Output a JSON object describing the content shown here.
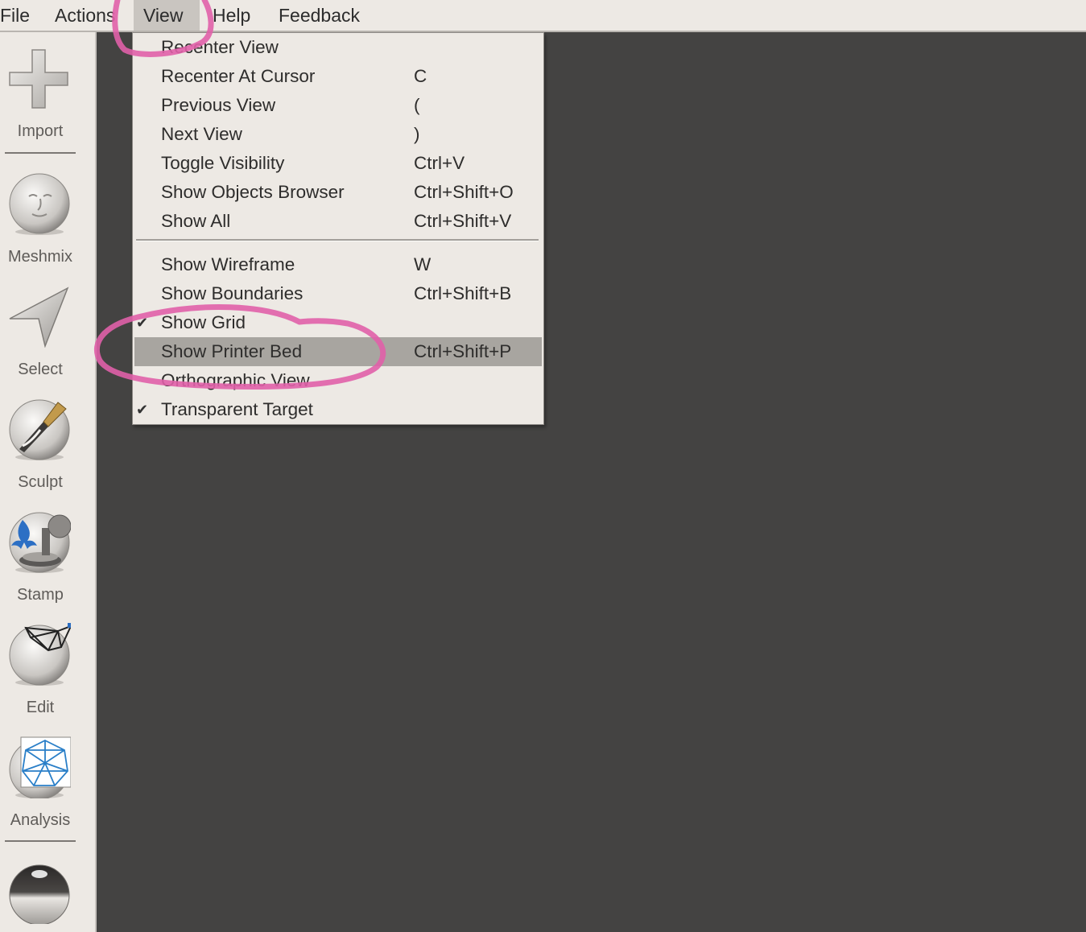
{
  "menubar": {
    "items": [
      "File",
      "Actions",
      "View",
      "Help",
      "Feedback"
    ],
    "active": "View"
  },
  "toolbar": {
    "tools": [
      {
        "label": "Import",
        "icon": "plus-icon"
      },
      {
        "label": "Meshmix",
        "icon": "face-sphere-icon"
      },
      {
        "label": "Select",
        "icon": "cursor-arrow-icon"
      },
      {
        "label": "Sculpt",
        "icon": "brush-sphere-icon"
      },
      {
        "label": "Stamp",
        "icon": "fleur-de-lis-stamp-icon"
      },
      {
        "label": "Edit",
        "icon": "wireframe-sphere-icon"
      },
      {
        "label": "Analysis",
        "icon": "mesh-analysis-icon"
      },
      {
        "label": "",
        "icon": "chrome-sphere-icon"
      }
    ]
  },
  "view_menu": {
    "group1": [
      {
        "label": "Recenter View",
        "shortcut": ""
      },
      {
        "label": "Recenter At Cursor",
        "shortcut": "C"
      },
      {
        "label": "Previous View",
        "shortcut": "("
      },
      {
        "label": "Next View",
        "shortcut": ")"
      },
      {
        "label": "Toggle Visibility",
        "shortcut": "Ctrl+V"
      },
      {
        "label": "Show Objects Browser",
        "shortcut": "Ctrl+Shift+O"
      },
      {
        "label": "Show All",
        "shortcut": "Ctrl+Shift+V"
      }
    ],
    "group2": [
      {
        "label": "Show Wireframe",
        "shortcut": "W",
        "checked": false
      },
      {
        "label": "Show Boundaries",
        "shortcut": "Ctrl+Shift+B",
        "checked": false
      },
      {
        "label": "Show Grid",
        "shortcut": "",
        "checked": true
      },
      {
        "label": "Show Printer Bed",
        "shortcut": "Ctrl+Shift+P",
        "checked": false,
        "highlighted": true
      },
      {
        "label": "Orthographic View",
        "shortcut": "",
        "checked": false
      },
      {
        "label": "Transparent Target",
        "shortcut": "",
        "checked": true
      }
    ],
    "check_glyph": "✔"
  },
  "colors": {
    "viewport": "#444342",
    "panel": "#ede9e4",
    "highlight": "#a8a5a0",
    "annotation": "#e060a8"
  }
}
